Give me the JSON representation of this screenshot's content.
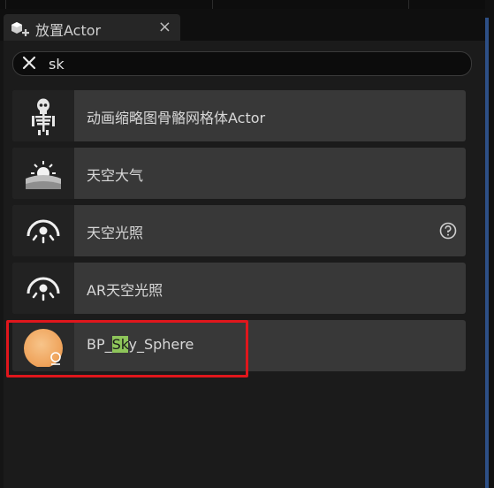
{
  "tab": {
    "title": "放置Actor",
    "close": "×",
    "icon": "place-actor-icon"
  },
  "search": {
    "value": "sk",
    "clear_icon": "close-icon"
  },
  "items": [
    {
      "label": "动画缩略图骨骼网格体Actor",
      "icon": "skeleton-icon"
    },
    {
      "label": "天空大气",
      "icon": "sky-atmosphere-icon"
    },
    {
      "label": "天空光照",
      "icon": "sky-light-icon",
      "help_icon": "help-icon"
    },
    {
      "label": "AR天空光照",
      "icon": "ar-sky-light-icon"
    },
    {
      "label_pre": "BP_",
      "label_match": "Sk",
      "label_post": "y_Sphere",
      "icon": "blueprint-sphere-icon",
      "selected": true
    }
  ],
  "colors": {
    "highlight": "#8ec55a",
    "selection_outline": "#e0161c",
    "sphere": "#f3b472"
  }
}
